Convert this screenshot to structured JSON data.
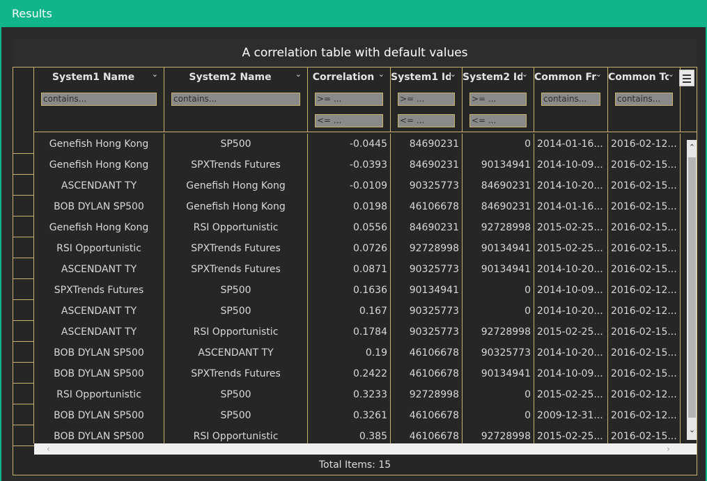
{
  "window": {
    "title": "Results"
  },
  "grid": {
    "title": "A correlation table with default values",
    "footer": "Total Items: 15",
    "columns": [
      {
        "label": "System1 Name",
        "filters": [
          "contains..."
        ]
      },
      {
        "label": "System2 Name",
        "filters": [
          "contains..."
        ]
      },
      {
        "label": "Correlation",
        "filters": [
          ">= ...",
          "<= ..."
        ]
      },
      {
        "label": "System1 Id...",
        "filters": [
          ">= ...",
          "<= ..."
        ]
      },
      {
        "label": "System2 Id...",
        "filters": [
          ">= ...",
          "<= ..."
        ]
      },
      {
        "label": "Common Fr...",
        "filters": [
          "contains..."
        ]
      },
      {
        "label": "Common To...",
        "filters": [
          "contains..."
        ]
      }
    ],
    "rows": [
      [
        "Genefish Hong Kong",
        "SP500",
        "-0.0445",
        "84690231",
        "0",
        "2014-01-16...",
        "2016-02-12..."
      ],
      [
        "Genefish Hong Kong",
        "SPXTrends Futures",
        "-0.0393",
        "84690231",
        "90134941",
        "2014-10-09...",
        "2016-02-15..."
      ],
      [
        "ASCENDANT TY",
        "Genefish Hong Kong",
        "-0.0109",
        "90325773",
        "84690231",
        "2014-10-20...",
        "2016-02-15..."
      ],
      [
        "BOB DYLAN SP500",
        "Genefish Hong Kong",
        "0.0198",
        "46106678",
        "84690231",
        "2014-01-16...",
        "2016-02-15..."
      ],
      [
        "Genefish Hong Kong",
        "RSI Opportunistic",
        "0.0556",
        "84690231",
        "92728998",
        "2015-02-25...",
        "2016-02-15..."
      ],
      [
        "RSI Opportunistic",
        "SPXTrends Futures",
        "0.0726",
        "92728998",
        "90134941",
        "2015-02-25...",
        "2016-02-15..."
      ],
      [
        "ASCENDANT TY",
        "SPXTrends Futures",
        "0.0871",
        "90325773",
        "90134941",
        "2014-10-20...",
        "2016-02-15..."
      ],
      [
        "SPXTrends Futures",
        "SP500",
        "0.1636",
        "90134941",
        "0",
        "2014-10-09...",
        "2016-02-12..."
      ],
      [
        "ASCENDANT TY",
        "SP500",
        "0.167",
        "90325773",
        "0",
        "2014-10-20...",
        "2016-02-12..."
      ],
      [
        "ASCENDANT TY",
        "RSI Opportunistic",
        "0.1784",
        "90325773",
        "92728998",
        "2015-02-25...",
        "2016-02-15..."
      ],
      [
        "BOB DYLAN SP500",
        "ASCENDANT TY",
        "0.19",
        "46106678",
        "90325773",
        "2014-10-20...",
        "2016-02-15..."
      ],
      [
        "BOB DYLAN SP500",
        "SPXTrends Futures",
        "0.2422",
        "46106678",
        "90134941",
        "2014-10-09...",
        "2016-02-15..."
      ],
      [
        "RSI Opportunistic",
        "SP500",
        "0.3233",
        "92728998",
        "0",
        "2015-02-25...",
        "2016-02-12..."
      ],
      [
        "BOB DYLAN SP500",
        "SP500",
        "0.3261",
        "46106678",
        "0",
        "2009-12-31...",
        "2016-02-12..."
      ],
      [
        "BOB DYLAN SP500",
        "RSI Opportunistic",
        "0.385",
        "46106678",
        "92728998",
        "2015-02-25...",
        "2016-02-15..."
      ]
    ]
  },
  "icons": {
    "column_menu": "chevron-down-icon",
    "grid_menu": "hamburger-menu-icon",
    "scroll_up": "chevron-up-icon",
    "scroll_down": "chevron-down-icon",
    "scroll_left": "chevron-left-icon",
    "scroll_right": "chevron-right-icon"
  },
  "colors": {
    "accent": "#11b58a",
    "grid_border": "#c8b46a",
    "background": "#2b2b2b",
    "filter_bg": "#8a8a8a"
  }
}
